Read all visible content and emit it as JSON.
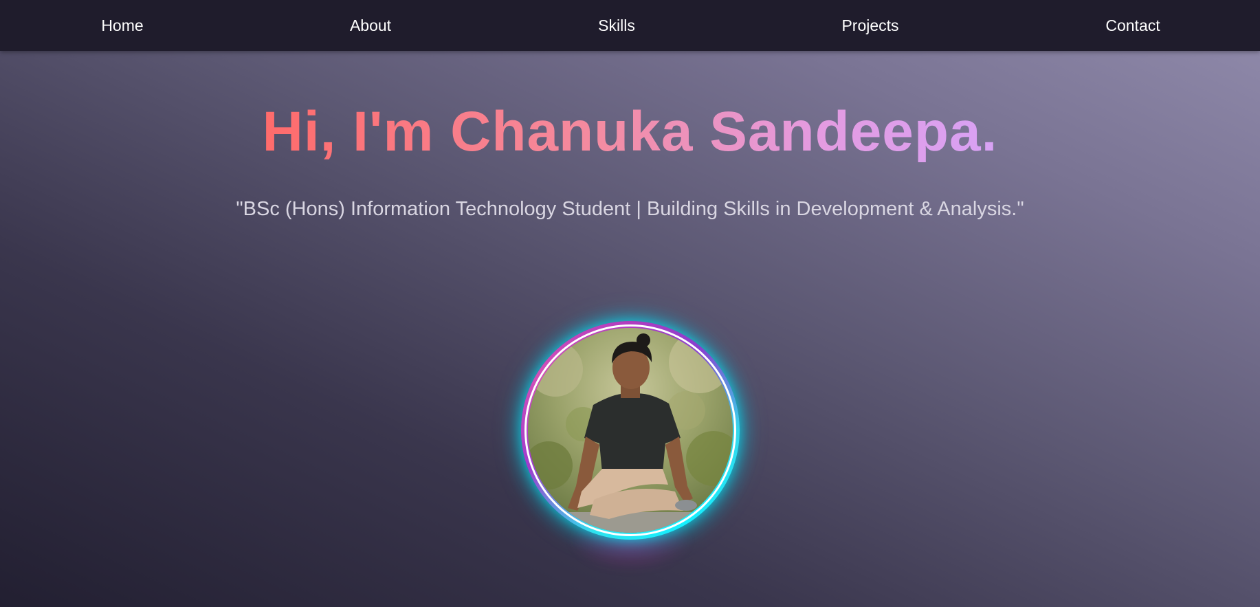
{
  "nav": {
    "items": [
      {
        "label": "Home"
      },
      {
        "label": "About"
      },
      {
        "label": "Skills"
      },
      {
        "label": "Projects"
      },
      {
        "label": "Contact"
      }
    ]
  },
  "hero": {
    "title": "Hi, I'm Chanuka Sandeepa.",
    "subtitle": "\"BSc (Hons) Information Technology Student | Building Skills in Development & Analysis.\""
  },
  "colors": {
    "navbar_bg": "#1f1c2c",
    "title_gradient_start": "#ff6b6b",
    "title_gradient_end": "#d8a2f5",
    "ring_glow": "#14f0ff",
    "ring_accent": "#b23cc0"
  }
}
